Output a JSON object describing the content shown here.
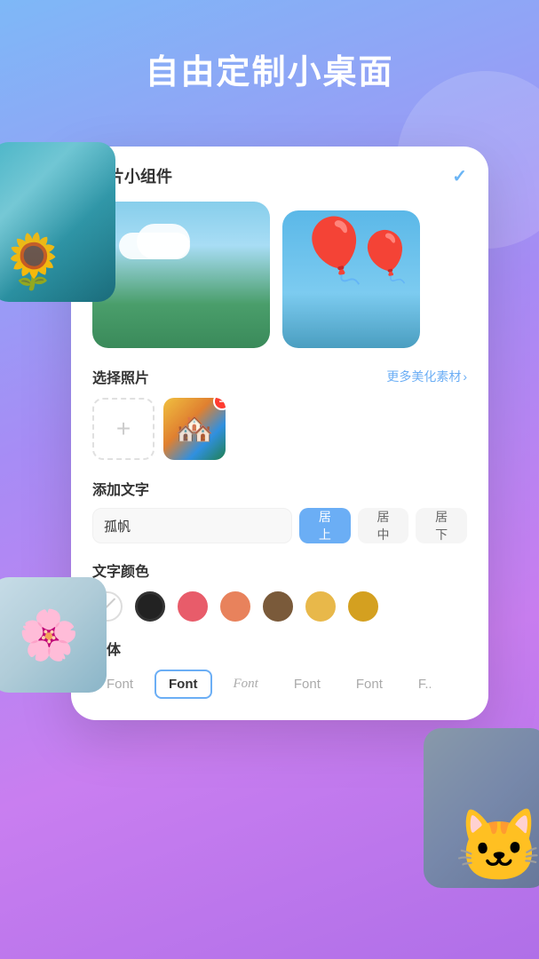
{
  "background": {
    "gradient": "linear-gradient(160deg, #7eb8f7 0%, #a78cf5 40%, #c97ef0 70%, #b06fe8 100%)"
  },
  "title": {
    "text": "自由定制小桌面"
  },
  "card": {
    "title": "图片小组件",
    "check_visible": true
  },
  "select_photos": {
    "label": "选择照片",
    "more_link": "更多美化素材",
    "add_plus": "+"
  },
  "add_text": {
    "label": "添加文字",
    "input_value": "孤帆",
    "positions": [
      {
        "label": "居上",
        "active": true
      },
      {
        "label": "居中",
        "active": false
      },
      {
        "label": "居下",
        "active": false
      }
    ]
  },
  "text_color": {
    "label": "文字颜色",
    "swatches": [
      {
        "color": "none",
        "label": "无"
      },
      {
        "color": "#222222",
        "label": "黑色"
      },
      {
        "color": "#e85c6a",
        "label": "红粉"
      },
      {
        "color": "#e8825c",
        "label": "橙色"
      },
      {
        "color": "#7a5a3a",
        "label": "棕色"
      },
      {
        "color": "#e8b84a",
        "label": "橙黄"
      },
      {
        "color": "#d4a020",
        "label": "金色"
      }
    ]
  },
  "font": {
    "label": "字体",
    "options": [
      {
        "label": "Font",
        "style": "sans",
        "selected": false
      },
      {
        "label": "Font",
        "style": "sans-bold",
        "selected": true
      },
      {
        "label": "Font",
        "style": "italic",
        "selected": false
      },
      {
        "label": "Font",
        "style": "sans2",
        "selected": false
      },
      {
        "label": "Font",
        "style": "sans3",
        "selected": false
      },
      {
        "label": "F...",
        "style": "partial",
        "selected": false
      }
    ]
  }
}
